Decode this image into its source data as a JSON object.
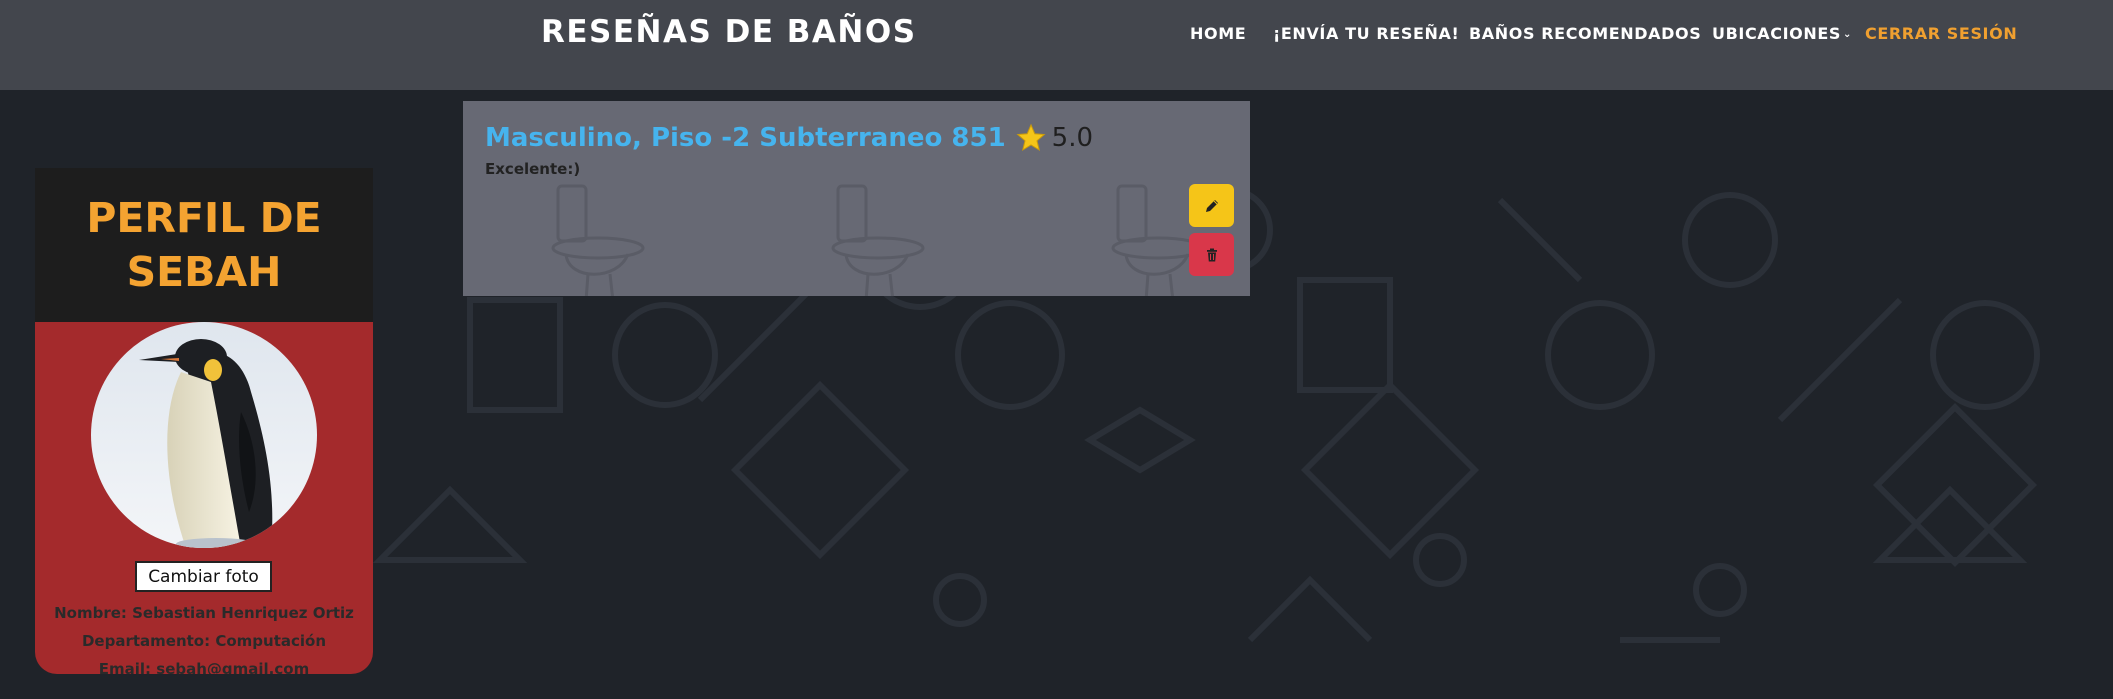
{
  "header": {
    "brand": "RESEÑAS DE BAÑOS",
    "nav": [
      {
        "label": "HOME"
      },
      {
        "label": "¡ENVÍA TU RESEÑA!"
      },
      {
        "label": "BAÑOS RECOMENDADOS"
      },
      {
        "label": "UBICACIONES",
        "icon": "chevron-down-icon"
      },
      {
        "label": "CERRAR SESIÓN"
      }
    ]
  },
  "profile": {
    "title": "PERFIL DE SEBAH",
    "avatar_icon": "penguin-photo",
    "change_photo_label": "Cambiar foto",
    "name_line": "Nombre: Sebastian Henriquez Ortiz",
    "department_line": "Departamento: Computación",
    "email_line": "Email: sebah@gmail.com"
  },
  "review": {
    "place": "Masculino, Piso -2 Subterraneo 851",
    "rating": "5.0",
    "comment": "Excelente:)",
    "edit_icon": "pencil-icon",
    "delete_icon": "trash-icon"
  },
  "colors": {
    "accent_orange": "#f4a331",
    "link_blue": "#46b4ee",
    "edit_yellow": "#f5c518",
    "delete_red": "#d9374a",
    "profile_red": "#a42a2c"
  }
}
